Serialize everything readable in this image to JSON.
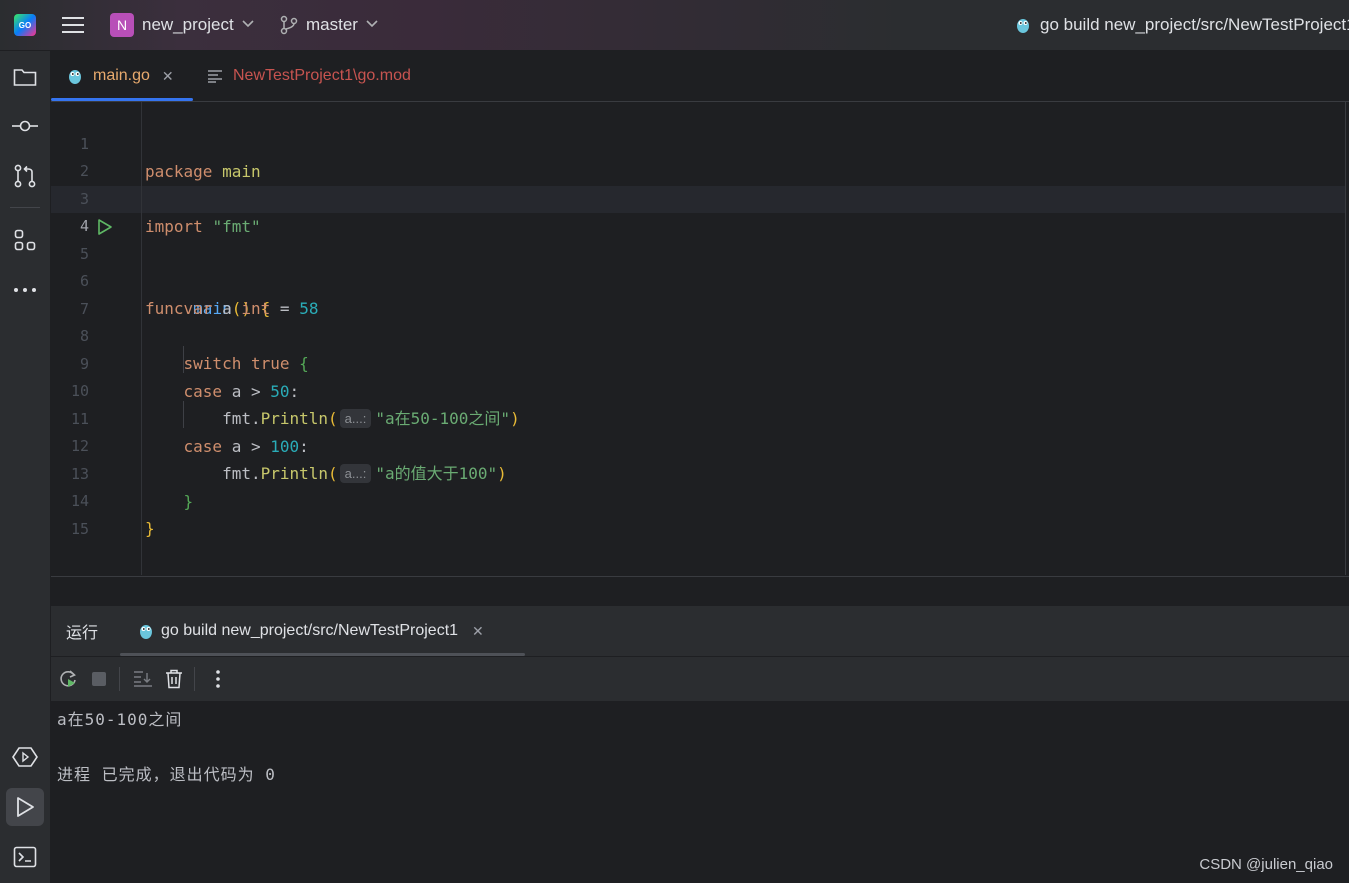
{
  "header": {
    "logo_text": "GO",
    "project_badge": "N",
    "project_name": "new_project",
    "branch": "master",
    "run_config": "go build new_project/src/NewTestProject1"
  },
  "sidebar": {
    "items": [
      "project-icon",
      "commit-icon",
      "pull-requests-icon",
      "structure-icon",
      "more-icon"
    ],
    "bottom_items": [
      "services-icon",
      "run-icon",
      "terminal-icon"
    ]
  },
  "tabs": [
    {
      "label": "main.go",
      "active": true,
      "close": "✕"
    },
    {
      "label": "NewTestProject1\\go.mod",
      "active": false
    }
  ],
  "editor": {
    "current_line": 4,
    "lines": [
      {
        "n": "1"
      },
      {
        "n": "2"
      },
      {
        "n": "3"
      },
      {
        "n": "4"
      },
      {
        "n": "5"
      },
      {
        "n": "6"
      },
      {
        "n": "7"
      },
      {
        "n": "8"
      },
      {
        "n": "9"
      },
      {
        "n": "10"
      },
      {
        "n": "11"
      },
      {
        "n": "12"
      },
      {
        "n": "13"
      },
      {
        "n": "14"
      },
      {
        "n": "15"
      }
    ],
    "tokens": {
      "package_kw": "package",
      "package_name": "main",
      "import_kw": "import",
      "import_path": "\"fmt\"",
      "func_kw": "func",
      "func_name": "main",
      "func_parens": "()",
      "open_brace": "{",
      "var_kw": "var",
      "var_name": "a",
      "var_type": "int",
      "assign": "=",
      "var_value": "58",
      "switch_kw": "switch",
      "switch_true": "true",
      "switch_brace": "{",
      "case_kw": "case",
      "case1_expr": "a >",
      "case1_num": "50",
      "colon": ":",
      "fmt_pkg": "fmt.",
      "println": "Println",
      "paren_open": "(",
      "paren_close": ")",
      "hint": "a...:",
      "print1_str": "\"a在50-100之间\"",
      "case2_num": "100",
      "print2_str": "\"a的值大于100\"",
      "close_brace": "}"
    }
  },
  "run_panel": {
    "label": "运行",
    "tab_label": "go build new_project/src/NewTestProject1",
    "tab_close": "✕",
    "output": [
      "a在50-100之间",
      "",
      "进程 已完成，退出代码为 0"
    ]
  },
  "watermark": "CSDN @julien_qiao"
}
